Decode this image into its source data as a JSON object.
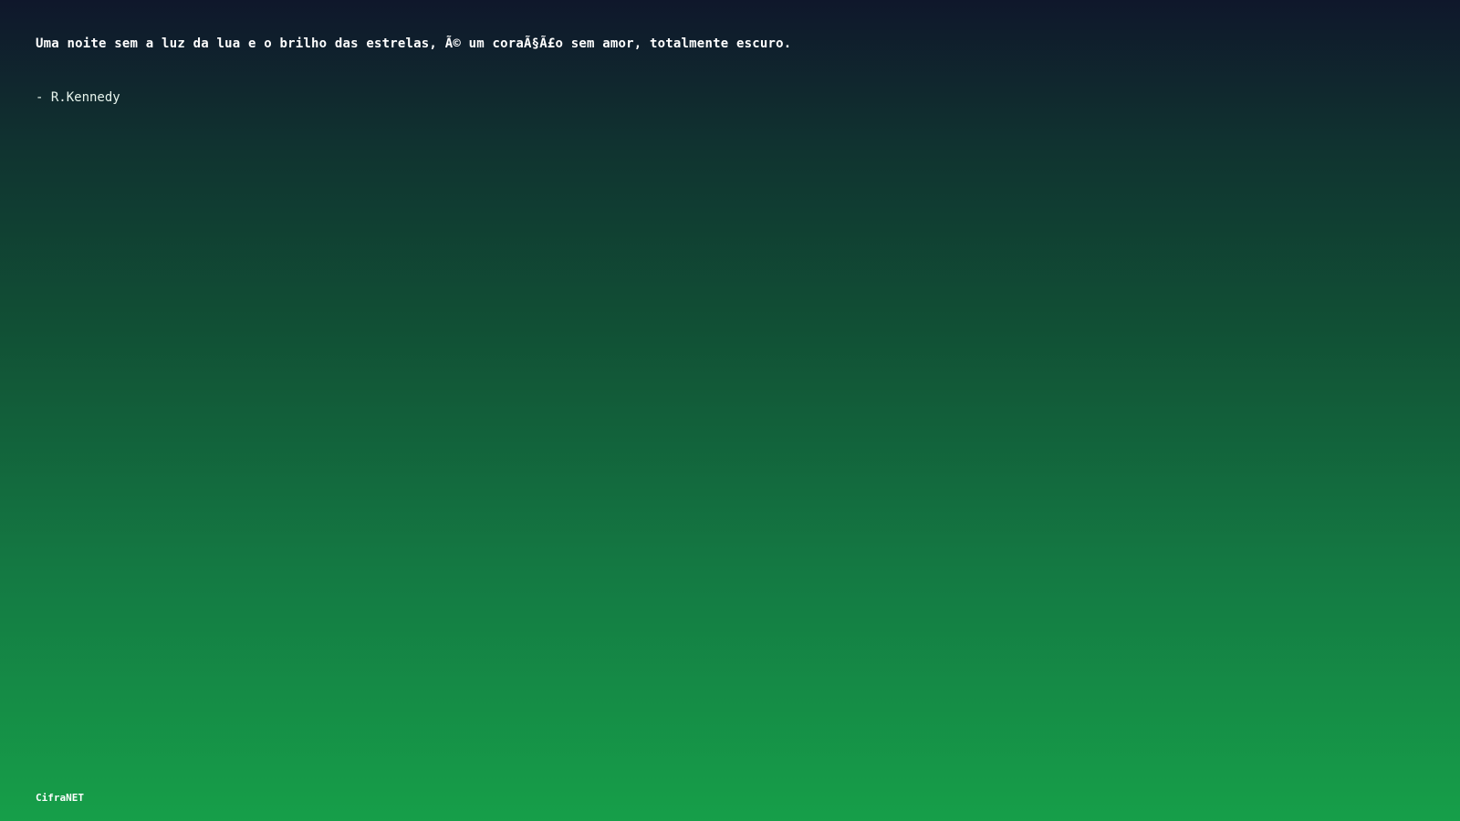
{
  "quote": {
    "text": "Uma noite sem a luz da lua e o brilho das estrelas, Ã© um coraÃ§Ã£o sem amor, totalmente escuro.",
    "author": "- R.Kennedy"
  },
  "footer": {
    "brand": "CifraNET"
  },
  "colors": {
    "background_top": "#0f172b",
    "background_bottom": "#169f49",
    "text": "#ffffff"
  }
}
